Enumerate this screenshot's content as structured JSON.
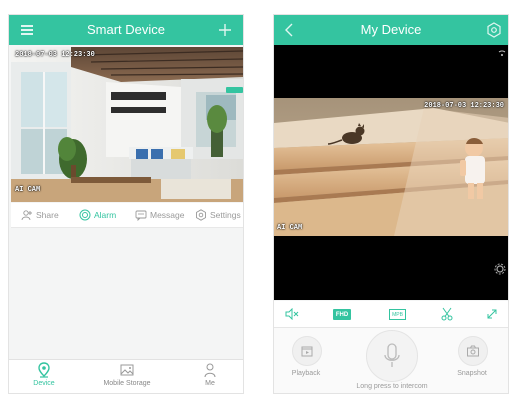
{
  "left_screen": {
    "header": {
      "title": "Smart Device",
      "menu_icon": "list-icon",
      "add_icon": "plus-icon"
    },
    "camera_card": {
      "timestamp": "2018-07-03 12:23:30",
      "camera_name": "AI CAM",
      "actions": [
        {
          "label": "Share",
          "icon": "share-icon"
        },
        {
          "label": "Alarm",
          "icon": "alarm-icon"
        },
        {
          "label": "Message",
          "icon": "message-icon"
        },
        {
          "label": "Settings",
          "icon": "settings-icon"
        }
      ]
    },
    "bottom_nav": [
      {
        "label": "Device",
        "icon": "location-pin-icon"
      },
      {
        "label": "Mobile Storage",
        "icon": "image-icon"
      },
      {
        "label": "Me",
        "icon": "person-icon"
      }
    ]
  },
  "right_screen": {
    "header": {
      "title": "My Device",
      "back_icon": "chevron-left-icon",
      "settings_icon": "gear-icon"
    },
    "video": {
      "timestamp": "2018-07-03 12:23:30",
      "camera_name": "AI CAM"
    },
    "controls": [
      {
        "label": "",
        "icon": "mute-icon"
      },
      {
        "label": "FHD",
        "icon": "fhd-badge"
      },
      {
        "label": "MPB",
        "icon": "screen-badge"
      },
      {
        "label": "",
        "icon": "scissors-icon"
      },
      {
        "label": "",
        "icon": "fullscreen-icon"
      }
    ],
    "intercom": {
      "playback_label": "Playback",
      "intercom_label": "Long press to intercom",
      "snapshot_label": "Snapshot"
    }
  },
  "colors": {
    "accent": "#34c4a0",
    "video_bg": "#000000",
    "text_muted": "#9a9a9a"
  }
}
